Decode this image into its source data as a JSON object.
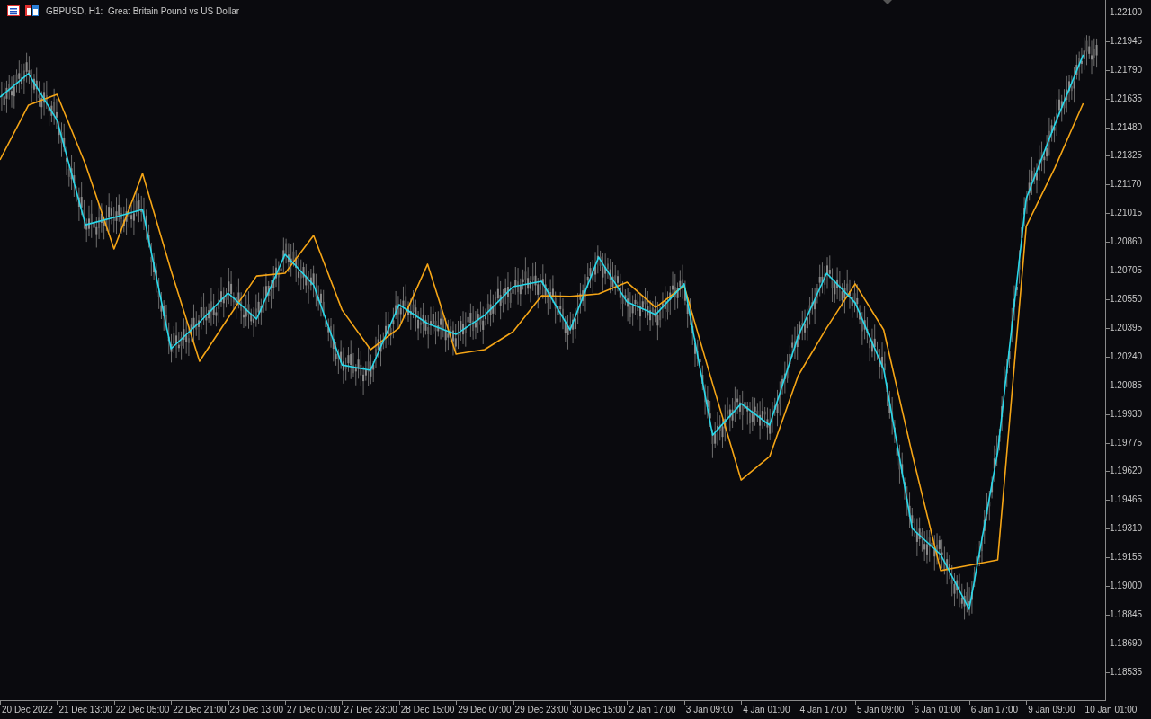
{
  "chart": {
    "title": "GBPUSD, H1:  Great Britain Pound vs US Dollar",
    "chart_data": {
      "type": "line",
      "categories": [
        null,
        "20 Dec 2022",
        null,
        "21 Dec 13:00",
        null,
        "22 Dec 05:00",
        null,
        "22 Dec 21:00",
        null,
        "23 Dec 13:00",
        null,
        "27 Dec 07:00",
        null,
        "27 Dec 23:00",
        null,
        "28 Dec 15:00",
        null,
        "29 Dec 07:00",
        null,
        "29 Dec 23:00",
        null,
        "30 Dec 15:00",
        null,
        "2 Jan 17:00",
        null,
        "3 Jan 09:00",
        null,
        "4 Jan 01:00",
        null,
        "4 Jan 17:00",
        null,
        "5 Jan 09:00",
        null,
        "6 Jan 01:00",
        null,
        "6 Jan 17:00",
        null,
        "9 Jan 09:00",
        null,
        "10 Jan 01:00"
      ],
      "series": [
        {
          "color": "#28d8ea",
          "values": [
            1.21643,
            1.2177,
            1.21519,
            1.20953,
            1.20992,
            1.21036,
            1.20283,
            1.20426,
            1.20584,
            1.20443,
            1.20793,
            1.20628,
            1.20195,
            1.20166,
            1.20521,
            1.20419,
            1.20361,
            1.20463,
            1.20618,
            1.20647,
            1.20385,
            1.20778,
            1.20535,
            1.20467,
            1.20633,
            1.19816,
            1.19986,
            1.1987,
            1.20351,
            1.20691,
            1.20531,
            1.20171,
            1.19311,
            1.1917,
            1.18874,
            1.19724,
            1.21094,
            1.21493,
            1.21872,
            null
          ]
        },
        {
          "color": "#f5a516",
          "values": [
            1.21303,
            1.216,
            1.21658,
            1.21279,
            1.20822,
            1.2123,
            1.20705,
            1.20215,
            1.20448,
            1.20676,
            1.20691,
            1.20895,
            1.20492,
            1.20278,
            1.20395,
            1.2074,
            1.20254,
            1.20278,
            1.20375,
            1.20569,
            1.20565,
            1.20579,
            1.20642,
            1.20506,
            1.20623,
            1.20093,
            1.19573,
            1.197,
            1.20137,
            1.20395,
            1.20633,
            1.20385,
            1.19714,
            1.19083,
            1.19112,
            1.19141,
            1.20944,
            1.21259,
            1.21609,
            null
          ]
        }
      ],
      "ylim": [
        1.18383,
        1.22168
      ],
      "yticks": [
        {
          "value": 1.221,
          "label": "1.22100"
        },
        {
          "value": 1.21945,
          "label": "1.21945"
        },
        {
          "value": 1.2179,
          "label": "1.21790"
        },
        {
          "value": 1.21635,
          "label": "1.21635"
        },
        {
          "value": 1.2148,
          "label": "1.21480"
        },
        {
          "value": 1.21325,
          "label": "1.21325"
        },
        {
          "value": 1.2117,
          "label": "1.21170"
        },
        {
          "value": 1.21015,
          "label": "1.21015"
        },
        {
          "value": 1.2086,
          "label": "1.20860"
        },
        {
          "value": 1.20705,
          "label": "1.20705"
        },
        {
          "value": 1.2055,
          "label": "1.20550"
        },
        {
          "value": 1.20395,
          "label": "1.20395"
        },
        {
          "value": 1.2024,
          "label": "1.20240"
        },
        {
          "value": 1.20085,
          "label": "1.20085"
        },
        {
          "value": 1.1993,
          "label": "1.19930"
        },
        {
          "value": 1.19775,
          "label": "1.19775"
        },
        {
          "value": 1.1962,
          "label": "1.19620"
        },
        {
          "value": 1.19465,
          "label": "1.19465"
        },
        {
          "value": 1.1931,
          "label": "1.19310"
        },
        {
          "value": 1.19155,
          "label": "1.19155"
        },
        {
          "value": 1.19,
          "label": "1.19000"
        },
        {
          "value": 1.18845,
          "label": "1.18845"
        },
        {
          "value": 1.1869,
          "label": "1.18690"
        },
        {
          "value": 1.18535,
          "label": "1.18535"
        }
      ]
    }
  }
}
